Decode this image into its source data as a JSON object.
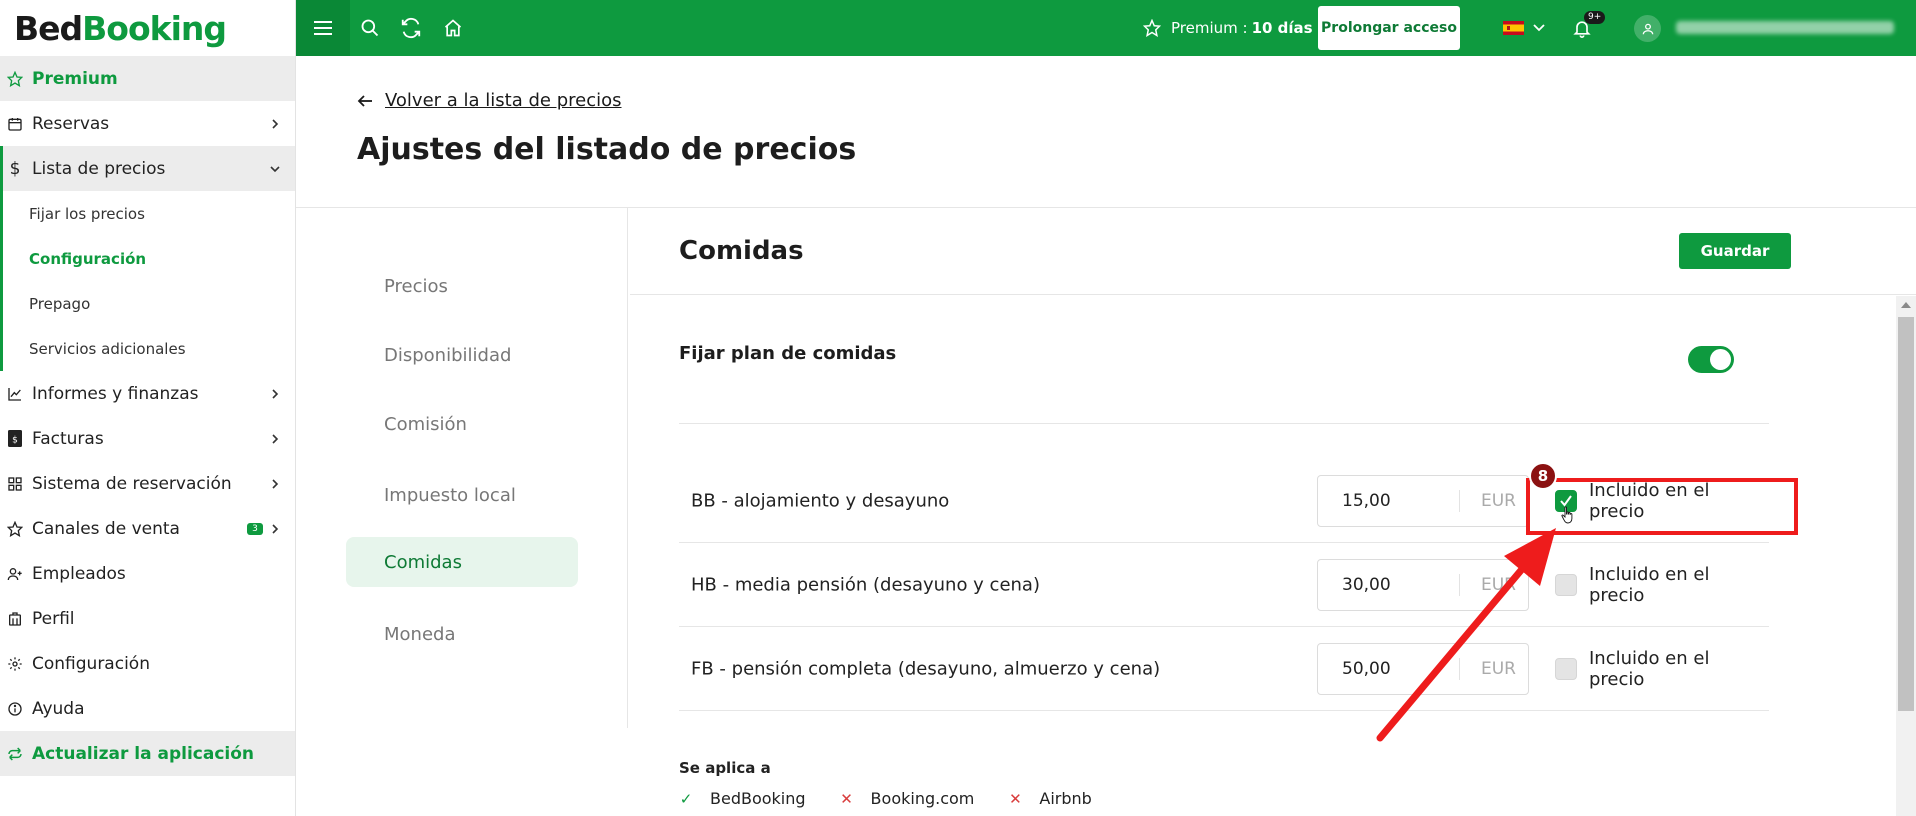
{
  "logo": {
    "part1": "Bed",
    "part2": "Booking"
  },
  "sidebar": {
    "premium": "Premium",
    "reservas": "Reservas",
    "lista_precios": "Lista de precios",
    "sub": {
      "fijar": "Fijar los precios",
      "configuracion": "Configuración",
      "prepago": "Prepago",
      "servicios": "Servicios adicionales"
    },
    "informes": "Informes y finanzas",
    "facturas": "Facturas",
    "sistema": "Sistema de reservación",
    "canales": "Canales de venta",
    "canales_badge": "3",
    "empleados": "Empleados",
    "perfil": "Perfil",
    "configuracion": "Configuración",
    "ayuda": "Ayuda",
    "actualizar": "Actualizar la aplicación"
  },
  "topbar": {
    "premium_label": "Premium :",
    "premium_days": "10 días",
    "prolong": "Prolongar acceso",
    "notif_count": "9+"
  },
  "header": {
    "back": "Volver a la lista de precios",
    "title": "Ajustes del listado de precios"
  },
  "tabs": [
    "Precios",
    "Disponibilidad",
    "Comisión",
    "Impuesto local",
    "Comidas",
    "Moneda"
  ],
  "section": {
    "title": "Comidas",
    "save": "Guardar",
    "plan_label": "Fijar plan de comidas",
    "plan_enabled": true
  },
  "meals": [
    {
      "name": "BB - alojamiento y desayuno",
      "price": "15,00",
      "currency": "EUR",
      "included_label": "Incluido en el precio",
      "included": true
    },
    {
      "name": "HB - media pensión (desayuno y cena)",
      "price": "30,00",
      "currency": "EUR",
      "included_label": "Incluido en el precio",
      "included": false
    },
    {
      "name": "FB - pensión completa (desayuno, almuerzo y cena)",
      "price": "50,00",
      "currency": "EUR",
      "included_label": "Incluido en el precio",
      "included": false
    }
  ],
  "apply": {
    "title": "Se aplica a",
    "channels": [
      {
        "name": "BedBooking",
        "enabled": true
      },
      {
        "name": "Booking.com",
        "enabled": false
      },
      {
        "name": "Airbnb",
        "enabled": false
      }
    ]
  },
  "annotation": {
    "step": "8"
  },
  "colors": {
    "brand": "#0e9a3f",
    "annotation": "#ee1c1c"
  }
}
